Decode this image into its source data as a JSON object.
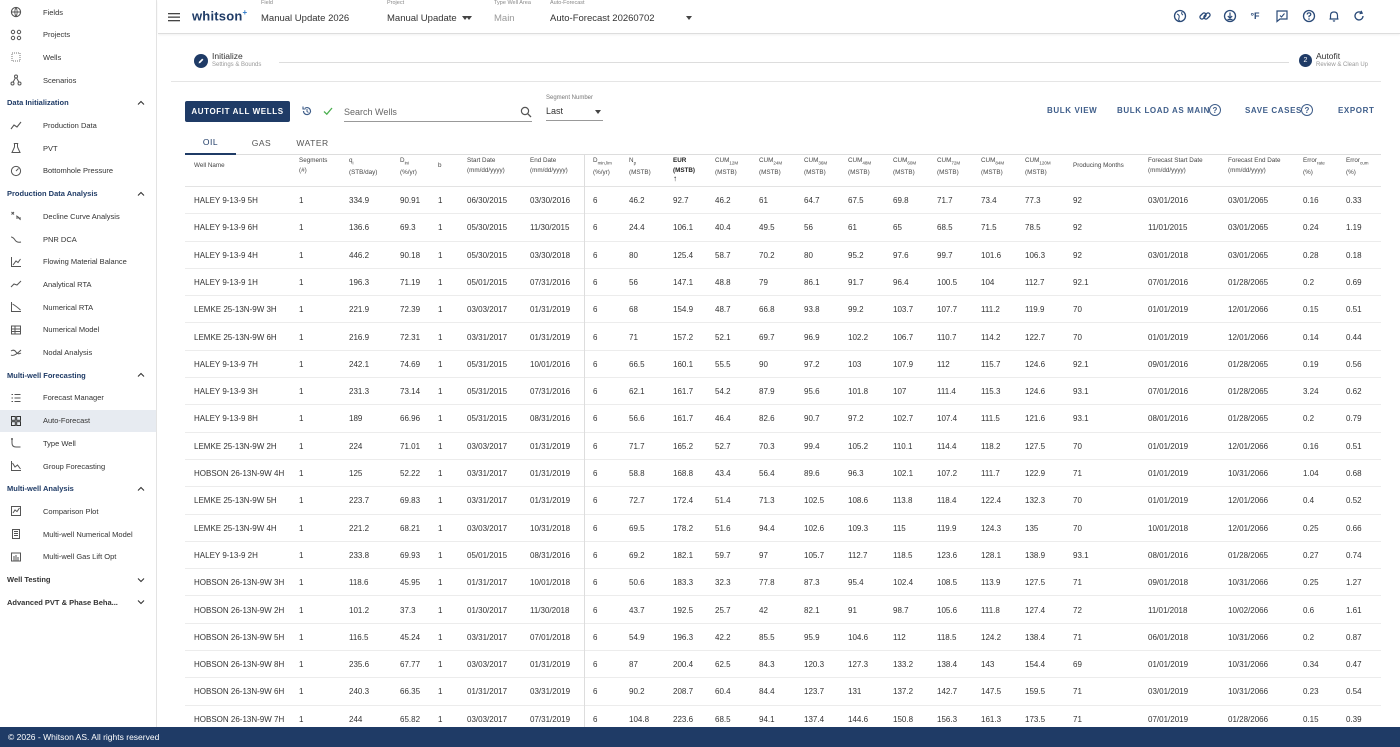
{
  "sidebar": {
    "top_items": [
      {
        "label": "Fields",
        "icon": "globe-icon"
      },
      {
        "label": "Projects",
        "icon": "projects-icon"
      },
      {
        "label": "Wells",
        "icon": "wells-icon"
      },
      {
        "label": "Scenarios",
        "icon": "scenarios-icon"
      }
    ],
    "sections": [
      {
        "title": "Data Initialization",
        "items": [
          {
            "label": "Production Data",
            "icon": "chart-line-icon"
          },
          {
            "label": "PVT",
            "icon": "flask-icon"
          },
          {
            "label": "Bottomhole Pressure",
            "icon": "gauge-icon"
          }
        ]
      },
      {
        "title": "Production Data Analysis",
        "items": [
          {
            "label": "Decline Curve Analysis",
            "icon": "dca-icon"
          },
          {
            "label": "PNR DCA",
            "icon": "pnr-icon"
          },
          {
            "label": "Flowing Material Balance",
            "icon": "fmb-icon"
          },
          {
            "label": "Analytical RTA",
            "icon": "analytical-rta-icon"
          },
          {
            "label": "Numerical RTA",
            "icon": "numerical-rta-icon"
          },
          {
            "label": "Numerical Model",
            "icon": "numerical-model-icon"
          },
          {
            "label": "Nodal Analysis",
            "icon": "nodal-icon"
          }
        ]
      },
      {
        "title": "Multi-well Forecasting",
        "items": [
          {
            "label": "Forecast Manager",
            "icon": "list-icon"
          },
          {
            "label": "Auto-Forecast",
            "icon": "grid-icon",
            "active": true
          },
          {
            "label": "Type Well",
            "icon": "type-well-icon"
          },
          {
            "label": "Group Forecasting",
            "icon": "group-forecast-icon"
          }
        ]
      },
      {
        "title": "Multi-well Analysis",
        "items": [
          {
            "label": "Comparison Plot",
            "icon": "comparison-icon"
          },
          {
            "label": "Multi-well Numerical Model",
            "icon": "multiwell-model-icon"
          },
          {
            "label": "Multi-well Gas Lift Opt",
            "icon": "gas-lift-icon"
          }
        ]
      }
    ],
    "collapsed_sections": [
      "Well Testing",
      "Advanced PVT & Phase Beha..."
    ]
  },
  "topbar": {
    "logo": "whitson",
    "logo_sup": "+",
    "field": {
      "caption": "Field",
      "value": "Manual Update 2026"
    },
    "project": {
      "caption": "Project",
      "value": "Manual Upadate"
    },
    "type_well_area": {
      "caption": "Type Well Area",
      "value": "Main"
    },
    "auto_forecast": {
      "caption": "Auto-Forecast",
      "value": "Auto-Forecast 20260702"
    },
    "unit_label": "°F"
  },
  "stepper": {
    "step1": {
      "title": "Initialize",
      "subtitle": "Settings & Bounds"
    },
    "step2": {
      "number": "2",
      "title": "Autofit",
      "subtitle": "Review & Clean Up"
    }
  },
  "toolbar": {
    "autofit_label": "AUTOFIT ALL WELLS",
    "search_placeholder": "Search Wells",
    "segment": {
      "caption": "Segment Number",
      "value": "Last"
    },
    "bulk_view": "BULK VIEW",
    "bulk_load": "BULK LOAD AS MAIN",
    "save_cases": "SAVE CASES",
    "export": "EXPORT"
  },
  "tabs": [
    "OIL",
    "GAS",
    "WATER"
  ],
  "table": {
    "headers": [
      {
        "l1": "Well Name",
        "l2": ""
      },
      {
        "l1": "Segments",
        "l2": "(#)"
      },
      {
        "l1": "q",
        "sub": "i",
        "l2": "(STB/day)"
      },
      {
        "l1": "D",
        "sub": "ini",
        "l2": "(%/yr)"
      },
      {
        "l1": "b",
        "l2": ""
      },
      {
        "l1": "Start Date",
        "l2": "(mm/dd/yyyy)"
      },
      {
        "l1": "End Date",
        "l2": "(mm/dd/yyyy)"
      },
      {
        "l1": "D",
        "sub": "min,lim",
        "l2": "(%/yr)"
      },
      {
        "l1": "N",
        "sub": "p",
        "l2": "(MSTB)"
      },
      {
        "l1": "EUR",
        "l2": "(MSTB)",
        "sorted": true
      },
      {
        "l1": "CUM",
        "sub": "12M",
        "l2": "(MSTB)"
      },
      {
        "l1": "CUM",
        "sub": "24M",
        "l2": "(MSTB)"
      },
      {
        "l1": "CUM",
        "sub": "36M",
        "l2": "(MSTB)"
      },
      {
        "l1": "CUM",
        "sub": "48M",
        "l2": "(MSTB)"
      },
      {
        "l1": "CUM",
        "sub": "60M",
        "l2": "(MSTB)"
      },
      {
        "l1": "CUM",
        "sub": "72M",
        "l2": "(MSTB)"
      },
      {
        "l1": "CUM",
        "sub": "84M",
        "l2": "(MSTB)"
      },
      {
        "l1": "CUM",
        "sub": "120M",
        "l2": "(MSTB)"
      },
      {
        "l1": "Producing Months",
        "l2": ""
      },
      {
        "l1": "Forecast Start Date",
        "l2": "(mm/dd/yyyy)"
      },
      {
        "l1": "Forecast End Date",
        "l2": "(mm/dd/yyyy)"
      },
      {
        "l1": "Error",
        "sub": "rate",
        "l2": "(%)"
      },
      {
        "l1": "Error",
        "sub": "cum",
        "l2": "(%)"
      }
    ],
    "sort_arrow": "↑",
    "rows": [
      [
        "HALEY 9-13-9 5H",
        "1",
        "334.9",
        "90.91",
        "1",
        "06/30/2015",
        "03/30/2016",
        "6",
        "46.2",
        "92.7",
        "46.2",
        "61",
        "64.7",
        "67.5",
        "69.8",
        "71.7",
        "73.4",
        "77.3",
        "92",
        "03/01/2016",
        "03/01/2065",
        "0.16",
        "0.33"
      ],
      [
        "HALEY 9-13-9 6H",
        "1",
        "136.6",
        "69.3",
        "1",
        "05/30/2015",
        "11/30/2015",
        "6",
        "24.4",
        "106.1",
        "40.4",
        "49.5",
        "56",
        "61",
        "65",
        "68.5",
        "71.5",
        "78.5",
        "92",
        "11/01/2015",
        "03/01/2065",
        "0.24",
        "1.19"
      ],
      [
        "HALEY 9-13-9 4H",
        "1",
        "446.2",
        "90.18",
        "1",
        "05/30/2015",
        "03/30/2018",
        "6",
        "80",
        "125.4",
        "58.7",
        "70.2",
        "80",
        "95.2",
        "97.6",
        "99.7",
        "101.6",
        "106.3",
        "92",
        "03/01/2018",
        "03/01/2065",
        "0.28",
        "0.18"
      ],
      [
        "HALEY 9-13-9 1H",
        "1",
        "196.3",
        "71.19",
        "1",
        "05/01/2015",
        "07/31/2016",
        "6",
        "56",
        "147.1",
        "48.8",
        "79",
        "86.1",
        "91.7",
        "96.4",
        "100.5",
        "104",
        "112.7",
        "92.1",
        "07/01/2016",
        "01/28/2065",
        "0.2",
        "0.69"
      ],
      [
        "LEMKE 25-13N-9W 3H",
        "1",
        "221.9",
        "72.39",
        "1",
        "03/03/2017",
        "01/31/2019",
        "6",
        "68",
        "154.9",
        "48.7",
        "66.8",
        "93.8",
        "99.2",
        "103.7",
        "107.7",
        "111.2",
        "119.9",
        "70",
        "01/01/2019",
        "12/01/2066",
        "0.15",
        "0.51"
      ],
      [
        "LEMKE 25-13N-9W 6H",
        "1",
        "216.9",
        "72.31",
        "1",
        "03/31/2017",
        "01/31/2019",
        "6",
        "71",
        "157.2",
        "52.1",
        "69.7",
        "96.9",
        "102.2",
        "106.7",
        "110.7",
        "114.2",
        "122.7",
        "70",
        "01/01/2019",
        "12/01/2066",
        "0.14",
        "0.44"
      ],
      [
        "HALEY 9-13-9 7H",
        "1",
        "242.1",
        "74.69",
        "1",
        "05/31/2015",
        "10/01/2016",
        "6",
        "66.5",
        "160.1",
        "55.5",
        "90",
        "97.2",
        "103",
        "107.9",
        "112",
        "115.7",
        "124.6",
        "92.1",
        "09/01/2016",
        "01/28/2065",
        "0.19",
        "0.56"
      ],
      [
        "HALEY 9-13-9 3H",
        "1",
        "231.3",
        "73.14",
        "1",
        "05/31/2015",
        "07/31/2016",
        "6",
        "62.1",
        "161.7",
        "54.2",
        "87.9",
        "95.6",
        "101.8",
        "107",
        "111.4",
        "115.3",
        "124.6",
        "93.1",
        "07/01/2016",
        "01/28/2065",
        "3.24",
        "0.62"
      ],
      [
        "HALEY 9-13-9 8H",
        "1",
        "189",
        "66.96",
        "1",
        "05/31/2015",
        "08/31/2016",
        "6",
        "56.6",
        "161.7",
        "46.4",
        "82.6",
        "90.7",
        "97.2",
        "102.7",
        "107.4",
        "111.5",
        "121.6",
        "93.1",
        "08/01/2016",
        "01/28/2065",
        "0.2",
        "0.79"
      ],
      [
        "LEMKE 25-13N-9W 2H",
        "1",
        "224",
        "71.01",
        "1",
        "03/03/2017",
        "01/31/2019",
        "6",
        "71.7",
        "165.2",
        "52.7",
        "70.3",
        "99.4",
        "105.2",
        "110.1",
        "114.4",
        "118.2",
        "127.5",
        "70",
        "01/01/2019",
        "12/01/2066",
        "0.16",
        "0.51"
      ],
      [
        "HOBSON 26-13N-9W 4H",
        "1",
        "125",
        "52.22",
        "1",
        "03/31/2017",
        "01/31/2019",
        "6",
        "58.8",
        "168.8",
        "43.4",
        "56.4",
        "89.6",
        "96.3",
        "102.1",
        "107.2",
        "111.7",
        "122.9",
        "71",
        "01/01/2019",
        "10/31/2066",
        "1.04",
        "0.68"
      ],
      [
        "LEMKE 25-13N-9W 5H",
        "1",
        "223.7",
        "69.83",
        "1",
        "03/31/2017",
        "01/31/2019",
        "6",
        "72.7",
        "172.4",
        "51.4",
        "71.3",
        "102.5",
        "108.6",
        "113.8",
        "118.4",
        "122.4",
        "132.3",
        "70",
        "01/01/2019",
        "12/01/2066",
        "0.4",
        "0.52"
      ],
      [
        "LEMKE 25-13N-9W 4H",
        "1",
        "221.2",
        "68.21",
        "1",
        "03/03/2017",
        "10/31/2018",
        "6",
        "69.5",
        "178.2",
        "51.6",
        "94.4",
        "102.6",
        "109.3",
        "115",
        "119.9",
        "124.3",
        "135",
        "70",
        "10/01/2018",
        "12/01/2066",
        "0.25",
        "0.66"
      ],
      [
        "HALEY 9-13-9 2H",
        "1",
        "233.8",
        "69.93",
        "1",
        "05/01/2015",
        "08/31/2016",
        "6",
        "69.2",
        "182.1",
        "59.7",
        "97",
        "105.7",
        "112.7",
        "118.5",
        "123.6",
        "128.1",
        "138.9",
        "93.1",
        "08/01/2016",
        "01/28/2065",
        "0.27",
        "0.74"
      ],
      [
        "HOBSON 26-13N-9W 3H",
        "1",
        "118.6",
        "45.95",
        "1",
        "01/31/2017",
        "10/01/2018",
        "6",
        "50.6",
        "183.3",
        "32.3",
        "77.8",
        "87.3",
        "95.4",
        "102.4",
        "108.5",
        "113.9",
        "127.5",
        "71",
        "09/01/2018",
        "10/31/2066",
        "0.25",
        "1.27"
      ],
      [
        "HOBSON 26-13N-9W 2H",
        "1",
        "101.2",
        "37.3",
        "1",
        "01/30/2017",
        "11/30/2018",
        "6",
        "43.7",
        "192.5",
        "25.7",
        "42",
        "82.1",
        "91",
        "98.7",
        "105.6",
        "111.8",
        "127.4",
        "72",
        "11/01/2018",
        "10/02/2066",
        "0.6",
        "1.61"
      ],
      [
        "HOBSON 26-13N-9W 5H",
        "1",
        "116.5",
        "45.24",
        "1",
        "03/31/2017",
        "07/01/2018",
        "6",
        "54.9",
        "196.3",
        "42.2",
        "85.5",
        "95.9",
        "104.6",
        "112",
        "118.5",
        "124.2",
        "138.4",
        "71",
        "06/01/2018",
        "10/31/2066",
        "0.2",
        "0.87"
      ],
      [
        "HOBSON 26-13N-9W 8H",
        "1",
        "235.6",
        "67.77",
        "1",
        "03/03/2017",
        "01/31/2019",
        "6",
        "87",
        "200.4",
        "62.5",
        "84.3",
        "120.3",
        "127.3",
        "133.2",
        "138.4",
        "143",
        "154.4",
        "69",
        "01/01/2019",
        "10/31/2066",
        "0.34",
        "0.47"
      ],
      [
        "HOBSON 26-13N-9W 6H",
        "1",
        "240.3",
        "66.35",
        "1",
        "01/31/2017",
        "03/31/2019",
        "6",
        "90.2",
        "208.7",
        "60.4",
        "84.4",
        "123.7",
        "131",
        "137.2",
        "142.7",
        "147.5",
        "159.5",
        "71",
        "03/01/2019",
        "10/31/2066",
        "0.23",
        "0.54"
      ],
      [
        "HOBSON 26-13N-9W 7H",
        "1",
        "244",
        "65.82",
        "1",
        "03/03/2017",
        "07/31/2019",
        "6",
        "104.8",
        "223.6",
        "68.5",
        "94.1",
        "137.4",
        "144.6",
        "150.8",
        "156.3",
        "161.3",
        "173.5",
        "71",
        "07/01/2019",
        "01/28/2066",
        "0.15",
        "0.39"
      ]
    ]
  },
  "footer": "© 2026 - Whitson AS. All rights reserved",
  "colors": {
    "primary": "#1f3b66",
    "link": "#3f5e8a",
    "active_bg": "#e7ebf1"
  }
}
